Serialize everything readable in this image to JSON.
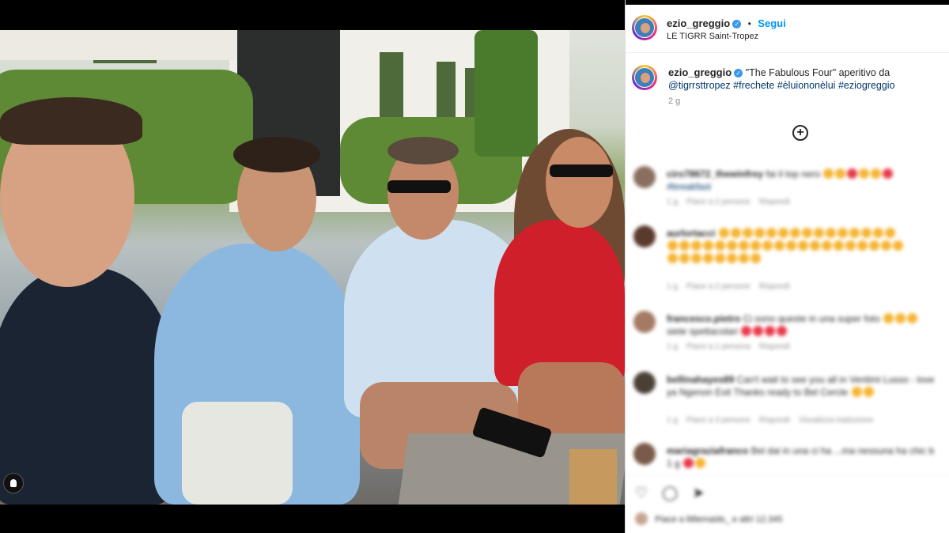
{
  "post": {
    "username": "ezio_greggio",
    "verified_mark": "✓",
    "separator": "•",
    "follow_label": "Segui",
    "location": "LE TIGRR Saint-Tropez"
  },
  "caption": {
    "username": "ezio_greggio",
    "text": "\"The Fabulous Four\" aperitivo da",
    "tags": [
      "@tigrrsttropez",
      "#frechete",
      "#èluiononèlui",
      "#eziogreggio"
    ],
    "time": "2 g"
  },
  "load_more_icon": "plus-circle-icon",
  "comments": [
    {
      "user": "ciro78672_thewinfrey",
      "text": "fai il top nero",
      "emoji": [
        "yellow",
        "yellow",
        "red",
        "yellow",
        "yellow",
        "red"
      ],
      "second_line": "#breakfast",
      "meta": [
        "1 g",
        "Piace a 2 persone",
        "Rispondi"
      ]
    },
    {
      "user": "aurlortacci",
      "text": "",
      "emoji_rows": 3,
      "meta": [
        "1 g",
        "Piace a 2 persone",
        "Rispondi"
      ]
    },
    {
      "user": "francesco.pietro",
      "text": "Ci sono queste in una super foto",
      "second_line": "siete spettacolari",
      "meta": [
        "1 g",
        "Piace a 1 persona",
        "Rispondi"
      ]
    },
    {
      "user": "bellinahayes89",
      "text": "Can't wait to see you all in Ventimi Lusso - love ya Ngenon Exit Thanks ready to Bel Cercle",
      "meta": [
        "1 g",
        "Piace a 3 persone",
        "Rispondi",
        "Visualizza traduzione"
      ]
    },
    {
      "user": "mariagraziafranco",
      "text": "Bel dai in una ci ha ...ma nessuna ha chic b",
      "meta": [
        "1 g"
      ]
    }
  ],
  "actions": {
    "like_icon": "heart-icon",
    "comment_icon": "comment-icon",
    "share_icon": "share-icon"
  },
  "likes": {
    "text": "Piace a littlemaids_ e altri 12.345"
  },
  "colors": {
    "accent_blue": "#0095f6",
    "tag_blue": "#00376b",
    "verified_blue": "#3897f0",
    "text": "#262626",
    "muted": "#8e8e8e"
  }
}
